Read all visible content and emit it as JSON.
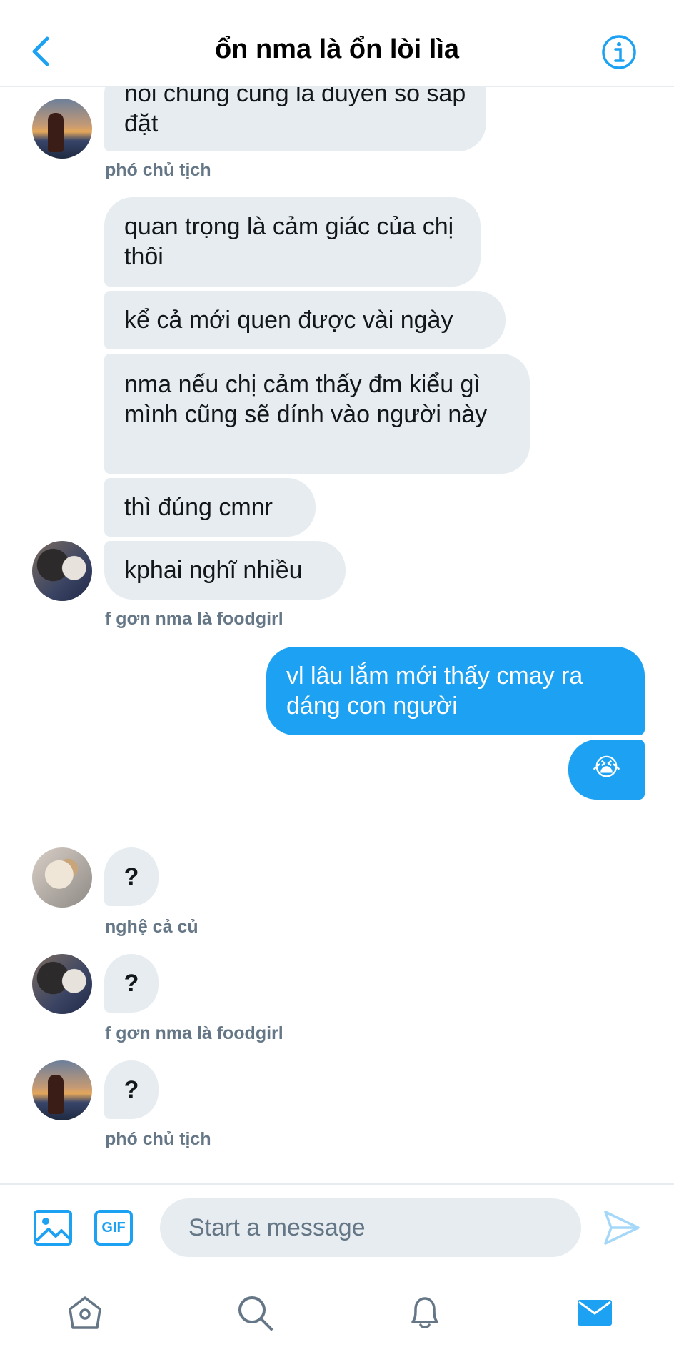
{
  "header": {
    "title": "ổn nma là ổn lòi lìa",
    "back_icon": "chevron-left-icon",
    "info_icon": "info-circle-icon",
    "accent_color": "#1da1f2"
  },
  "messages": [
    {
      "text": "nói chung cũng là duyên số sắp đặt",
      "direction": "incoming"
    },
    {
      "sender": "phó chủ tịch"
    },
    {
      "text": "quan trọng là cảm giác của chị thôi",
      "direction": "incoming"
    },
    {
      "text": "kể cả mới quen được vài ngày",
      "direction": "incoming"
    },
    {
      "text": "nma nếu chị cảm thấy đm kiểu gì mình cũng sẽ dính vào người này",
      "direction": "incoming"
    },
    {
      "text": "thì đúng cmnr",
      "direction": "incoming"
    },
    {
      "text": "kphai nghĩ nhiều",
      "direction": "incoming"
    },
    {
      "sender": "f gơn nma là foodgirl"
    },
    {
      "text": "vl lâu lắm mới thấy cmay ra dáng con người",
      "direction": "outgoing"
    },
    {
      "text": "😭",
      "direction": "outgoing"
    },
    {
      "text": "?",
      "direction": "incoming"
    },
    {
      "sender": "nghệ cả củ"
    },
    {
      "text": "?",
      "direction": "incoming"
    },
    {
      "sender": "f gơn nma là foodgirl"
    },
    {
      "text": "?",
      "direction": "incoming"
    },
    {
      "sender": "phó chủ tịch"
    }
  ],
  "composer": {
    "placeholder": "Start a message",
    "gif_label": "GIF",
    "image_icon": "image-icon",
    "send_icon": "send-icon"
  },
  "tabbar": {
    "items": [
      "home-icon",
      "search-icon",
      "notifications-bell-icon",
      "messages-envelope-icon"
    ],
    "active": "messages-envelope-icon"
  }
}
